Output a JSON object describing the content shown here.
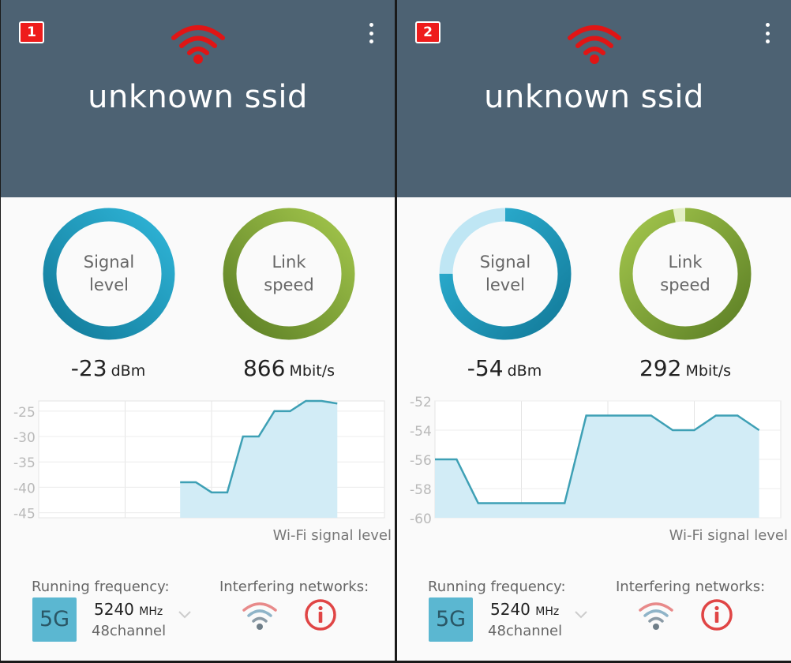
{
  "panels": [
    {
      "badge": "1",
      "ssid": "unknown ssid",
      "signal_gauge": {
        "label_line1": "Signal",
        "label_line2": "level",
        "value": "-23",
        "unit": "dBm",
        "fill_fraction": 1.0
      },
      "link_gauge": {
        "label_line1": "Link",
        "label_line2": "speed",
        "value": "866",
        "unit": "Mbit/s",
        "fill_fraction": 1.0
      },
      "chart_data": {
        "type": "area",
        "title": "Wi-Fi signal level",
        "ylabel": "",
        "yticks": [
          "-25",
          "-30",
          "-35",
          "-40",
          "-45"
        ],
        "ylim": [
          -46,
          -23
        ],
        "x": [
          0,
          1,
          2,
          3,
          4,
          5,
          6,
          7,
          8,
          9,
          10,
          11,
          12,
          13,
          14,
          15,
          16,
          17,
          18,
          19,
          20,
          21,
          22
        ],
        "values": [
          null,
          null,
          null,
          null,
          null,
          null,
          null,
          null,
          null,
          -39,
          -39,
          -41,
          -41,
          -30,
          -30,
          -25,
          -25,
          -23,
          -23,
          -23.5,
          null,
          null,
          null
        ],
        "series_start": 8,
        "colors": {
          "line": "#3ea0b5",
          "fill": "#d2ecf6"
        }
      },
      "freq_label": "Running frequency:",
      "band": "5G",
      "freq_value": "5240",
      "freq_unit": "MHz",
      "channel": "48channel",
      "interfering_label": "Interfering networks:"
    },
    {
      "badge": "2",
      "ssid": "unknown ssid",
      "signal_gauge": {
        "label_line1": "Signal",
        "label_line2": "level",
        "value": "-54",
        "unit": "dBm",
        "fill_fraction": 0.75
      },
      "link_gauge": {
        "label_line1": "Link",
        "label_line2": "speed",
        "value": "292",
        "unit": "Mbit/s",
        "fill_fraction": 0.97
      },
      "chart_data": {
        "type": "area",
        "title": "Wi-Fi signal level",
        "ylabel": "",
        "yticks": [
          "-52",
          "-54",
          "-56",
          "-58",
          "-60"
        ],
        "ylim": [
          -60,
          -52
        ],
        "x": [
          0,
          1,
          2,
          3,
          4,
          5,
          6,
          7,
          8,
          9,
          10,
          11,
          12,
          13,
          14,
          15,
          16
        ],
        "values": [
          -56,
          -56,
          -59,
          -59,
          -59,
          -59,
          -59,
          -53,
          -53,
          -53,
          -53,
          -54,
          -54,
          -53,
          -53,
          -54
        ],
        "series_start": 0,
        "colors": {
          "line": "#3ea0b5",
          "fill": "#d2ecf6"
        }
      },
      "freq_label": "Running frequency:",
      "band": "5G",
      "freq_value": "5240",
      "freq_unit": "MHz",
      "channel": "48channel",
      "interfering_label": "Interfering networks:"
    }
  ],
  "colors": {
    "header_bg": "#4d6273",
    "badge_bg": "#ee1c1c",
    "signal_ring": "#2aaed0",
    "signal_ring_dark": "#127a99",
    "signal_ring_empty": "#bfe6f4",
    "link_ring": "#9cbf45",
    "link_ring_dark": "#5c7f25",
    "link_ring_empty": "#e3efc4",
    "wifi_red": "#e01515",
    "info_red": "#e04545"
  },
  "icons": {
    "wifi": "wifi-icon",
    "menu": "more-vert-icon",
    "chevron": "chevron-down-icon",
    "interfering": "wifi-interference-icon",
    "info": "info-icon"
  }
}
